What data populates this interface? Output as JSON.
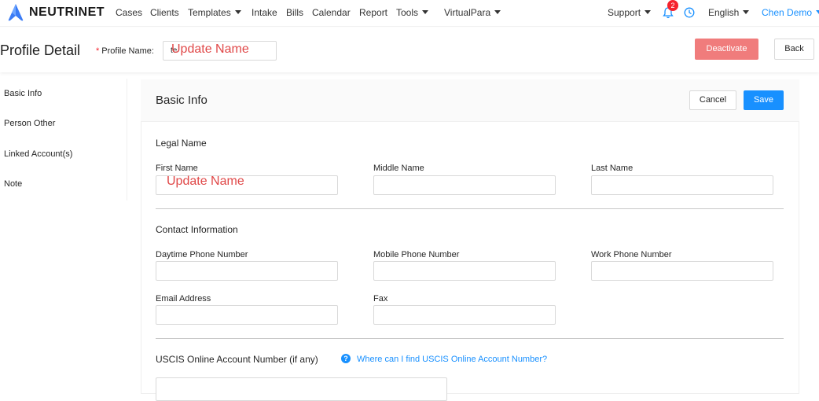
{
  "nav": {
    "brand": "NEUTRINET",
    "items": [
      "Cases",
      "Clients",
      "Templates",
      "Intake",
      "Bills",
      "Calendar",
      "Report",
      "Tools",
      "VirtualPara"
    ],
    "support": "Support",
    "notification_count": "2",
    "language": "English",
    "user": "Chen Demo",
    "accent": "#1890ff"
  },
  "header": {
    "title": "Profile Detail",
    "required_mark": "*",
    "profile_name_label": "Profile Name:",
    "profile_name_value": "te",
    "annotation": "Update Name",
    "deactivate_label": "Deactivate",
    "back_label": "Back"
  },
  "sidebar": {
    "items": [
      "Basic Info",
      "Person Other",
      "Linked Account(s)",
      "Note"
    ]
  },
  "card": {
    "title": "Basic Info",
    "cancel_label": "Cancel",
    "save_label": "Save"
  },
  "legal_name": {
    "title": "Legal Name",
    "first_name_label": "First Name",
    "first_name_annotation": "Update Name",
    "middle_name_label": "Middle Name",
    "last_name_label": "Last Name"
  },
  "contact": {
    "title": "Contact Information",
    "daytime_label": "Daytime Phone Number",
    "mobile_label": "Mobile Phone Number",
    "work_label": "Work Phone Number",
    "email_label": "Email Address",
    "fax_label": "Fax"
  },
  "uscis": {
    "title": "USCIS Online Account Number (if any)",
    "help_icon": "?",
    "help_link": "Where can I find USCIS Online Account Number?"
  }
}
